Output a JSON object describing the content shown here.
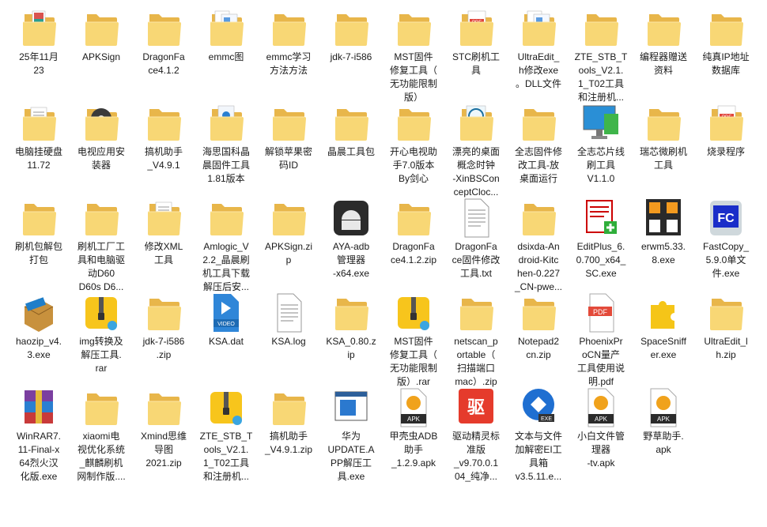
{
  "desktop": {
    "items": [
      {
        "label": "25年11月\n23",
        "icon": "folder-photo-icon"
      },
      {
        "label": "APKSign",
        "icon": "folder-icon"
      },
      {
        "label": "DragonFa\nce4.1.2",
        "icon": "folder-icon"
      },
      {
        "label": "emmc图",
        "icon": "folder-docs-icon"
      },
      {
        "label": "emmc学习\n方法方法",
        "icon": "folder-icon"
      },
      {
        "label": "jdk-7-i586",
        "icon": "folder-icon"
      },
      {
        "label": "MST固件\n修复工具（\n无功能限制\n版）",
        "icon": "folder-icon"
      },
      {
        "label": "STC刷机工\n具",
        "icon": "folder-pdf-icon"
      },
      {
        "label": "UltraEdit_\nh修改exe\n。DLL文件",
        "icon": "folder-docs-icon"
      },
      {
        "label": "ZTE_STB_T\nools_V2.1.\n1_T02工具\n和注册机...",
        "icon": "folder-icon"
      },
      {
        "label": "编程器赠送\n资料",
        "icon": "folder-icon"
      },
      {
        "label": "纯真IP地址\n数据库",
        "icon": "folder-icon"
      },
      {
        "label": "电脑挂硬盘\n11.72",
        "icon": "folder-doc-icon"
      },
      {
        "label": "电视应用安\n装器",
        "icon": "folder-disc-icon"
      },
      {
        "label": "搞机助手\n_V4.9.1",
        "icon": "folder-icon"
      },
      {
        "label": "海思国科晶\n晨固件工具\n1.81版本",
        "icon": "folder-zip-icon"
      },
      {
        "label": "解锁苹果密\n码ID",
        "icon": "folder-icon"
      },
      {
        "label": "晶晨工具包",
        "icon": "folder-icon"
      },
      {
        "label": "开心电视助\n手7.0版本\nBy剑心",
        "icon": "folder-icon"
      },
      {
        "label": "漂亮的桌面\n概念时钟\n-XinBSCon\nceptCloc...",
        "icon": "folder-clock-icon"
      },
      {
        "label": "全志固件修\n改工具-放\n桌面运行",
        "icon": "folder-icon"
      },
      {
        "label": "全志芯片线\n刷工具\nV1.1.0",
        "icon": "monitor-icon"
      },
      {
        "label": "瑞芯微刷机\n工具",
        "icon": "folder-icon"
      },
      {
        "label": "烧录程序",
        "icon": "folder-pdf-icon"
      },
      {
        "label": "刷机包解包\n打包",
        "icon": "folder-users-icon"
      },
      {
        "label": "刷机工厂工\n具和电脑驱\n动D60\nD60s D6...",
        "icon": "folder-icon"
      },
      {
        "label": "修改XML\n工具",
        "icon": "folder-doc-icon"
      },
      {
        "label": "Amlogic_V\n2.2_晶晨刷\n机工具下载\n解压后安...",
        "icon": "zip-folder-icon"
      },
      {
        "label": "APKSign.zi\np",
        "icon": "zip-folder-icon"
      },
      {
        "label": "AYA-adb\n管理器\n-x64.exe",
        "icon": "android-icon"
      },
      {
        "label": "DragonFa\nce4.1.2.zip",
        "icon": "zip-folder-icon"
      },
      {
        "label": "DragonFa\nce固件修改\n工具.txt",
        "icon": "text-file-icon"
      },
      {
        "label": "dsixda-An\ndroid-Kitc\nhen-0.227\n_CN-pwe...",
        "icon": "zip-folder-icon"
      },
      {
        "label": "EditPlus_6.\n0.700_x64_\nSC.exe",
        "icon": "editplus-icon"
      },
      {
        "label": "erwm5.33.\n8.exe",
        "icon": "qrcode-icon"
      },
      {
        "label": "FastCopy_\n5.9.0单文\n件.exe",
        "icon": "fastcopy-icon"
      },
      {
        "label": "haozip_v4.\n3.exe",
        "icon": "haozip-icon"
      },
      {
        "label": "img转换及\n解压工具.\nrar",
        "icon": "zip-yellow-icon"
      },
      {
        "label": "jdk-7-i586\n.zip",
        "icon": "zip-folder-icon"
      },
      {
        "label": "KSA.dat",
        "icon": "video-file-icon"
      },
      {
        "label": "KSA.log",
        "icon": "text-file-icon"
      },
      {
        "label": "KSA_0.80.z\nip",
        "icon": "zip-folder-icon"
      },
      {
        "label": "MST固件\n修复工具（\n无功能限制\n版）.rar",
        "icon": "zip-yellow-icon"
      },
      {
        "label": "netscan_p\nortable（\n扫描端口\nmac）.zip",
        "icon": "zip-folder-icon"
      },
      {
        "label": "Notepad2\ncn.zip",
        "icon": "zip-folder-icon"
      },
      {
        "label": "PhoenixPr\noCN量产\n工具使用说\n明.pdf",
        "icon": "pdf-file-icon"
      },
      {
        "label": "SpaceSniff\ner.exe",
        "icon": "puzzle-icon"
      },
      {
        "label": "UltraEdit_l\nh.zip",
        "icon": "zip-folder-icon"
      },
      {
        "label": "WinRAR7.\n11-Final-x\n64烈火汉\n化版.exe",
        "icon": "winrar-icon"
      },
      {
        "label": "xiaomi电\n视优化系统\n_麒麟刷机\n网制作版....",
        "icon": "zip-folder-icon"
      },
      {
        "label": "Xmind思维\n导图\n2021.zip",
        "icon": "zip-folder-icon"
      },
      {
        "label": "ZTE_STB_T\nools_V2.1.\n1_T02工具\n和注册机...",
        "icon": "zip-yellow-icon"
      },
      {
        "label": "搞机助手\n_V4.9.1.zip",
        "icon": "zip-folder-icon"
      },
      {
        "label": "华为\nUPDATE.A\nPP解压工\n具.exe",
        "icon": "app-window-icon"
      },
      {
        "label": "甲壳虫ADB\n助手\n_1.2.9.apk",
        "icon": "apk-icon"
      },
      {
        "label": "驱动精灵标\n准版\n_v9.70.0.1\n04_纯净...",
        "icon": "driver-icon"
      },
      {
        "label": "文本与文件\n加解密EI工\n具箱\nv3.5.11.e...",
        "icon": "exe-blue-icon"
      },
      {
        "label": "小白文件管\n理器\n-tv.apk",
        "icon": "apk-icon"
      },
      {
        "label": "野草助手.\napk",
        "icon": "apk-icon"
      }
    ]
  }
}
